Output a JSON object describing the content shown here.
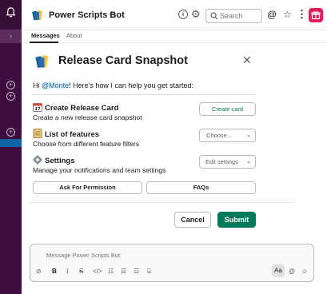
{
  "app": {
    "name": "Power Scripts Bot",
    "brand_color": "#3f0e40",
    "accent_green": "#007a5a"
  },
  "header": {
    "search_placeholder": "Search"
  },
  "tabs": [
    {
      "label": "Messages",
      "active": true
    },
    {
      "label": "About",
      "active": false
    }
  ],
  "modal": {
    "title": "Release Card Snapshot",
    "greeting_prefix": "Hi ",
    "greeting_mention": "@Monte",
    "greeting_suffix": "! Here's how I can help you get started:",
    "rows": [
      {
        "icon": "calendar-icon",
        "title": "Create Release Card",
        "description": "Create a new release card snapshot",
        "control": "Create card"
      },
      {
        "icon": "ledger-icon",
        "title": "List of features",
        "description": "Choose from different feature filters",
        "control": "Choose..."
      },
      {
        "icon": "gear-icon",
        "title": "Settings",
        "description": "Manage your notifications and team settings",
        "control": "Edit settings"
      }
    ],
    "ask_permission": "Ask For Permission",
    "faqs": "FAQs",
    "cancel": "Cancel",
    "submit": "Submit"
  },
  "composer": {
    "placeholder": "Message Power Scripts Bot",
    "format_label": "Aa"
  }
}
